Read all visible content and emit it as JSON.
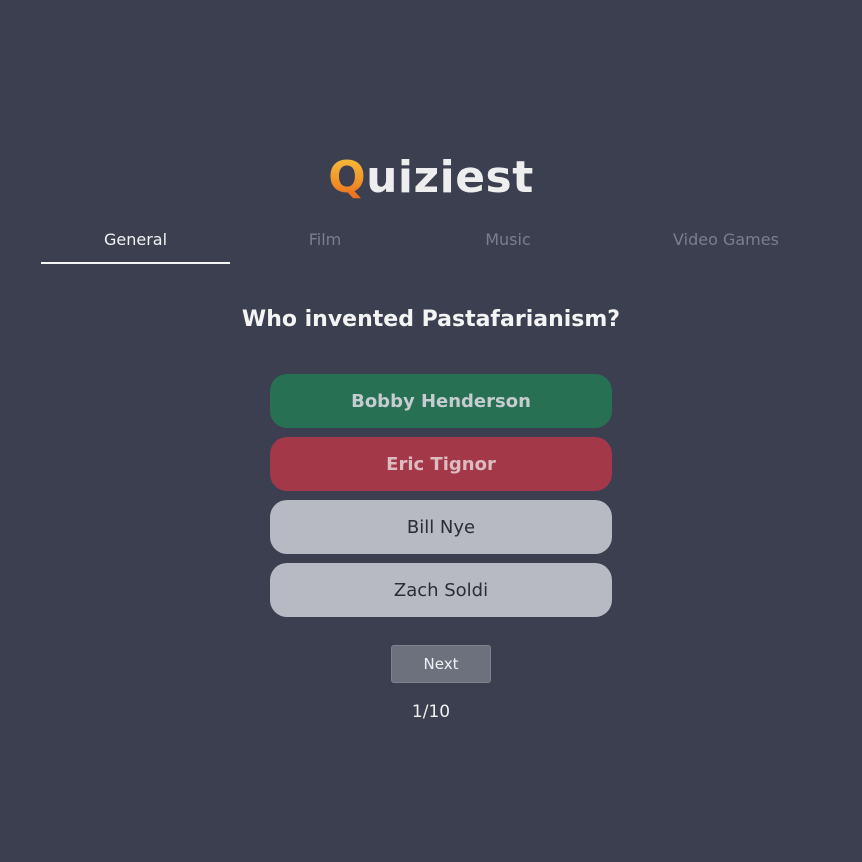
{
  "app": {
    "logo_first_letter": "Q",
    "logo_rest": "uiziest"
  },
  "tabs": [
    {
      "label": "General",
      "active": true
    },
    {
      "label": "Film",
      "active": false
    },
    {
      "label": "Music",
      "active": false
    },
    {
      "label": "Video Games",
      "active": false
    }
  ],
  "quiz": {
    "question": "Who invented Pastafarianism?",
    "answers": [
      {
        "label": "Bobby Henderson",
        "state": "correct"
      },
      {
        "label": "Eric Tignor",
        "state": "wrong"
      },
      {
        "label": "Bill Nye",
        "state": "neutral"
      },
      {
        "label": "Zach Soldi",
        "state": "neutral"
      }
    ],
    "next_label": "Next",
    "progress": "1/10"
  },
  "colors": {
    "background": "#3b3f4f",
    "correct": "#277054",
    "wrong": "#a23848",
    "neutral": "#b7bac3",
    "logo_gradient_top": "#f6c343",
    "logo_gradient_bottom": "#e8631e"
  }
}
